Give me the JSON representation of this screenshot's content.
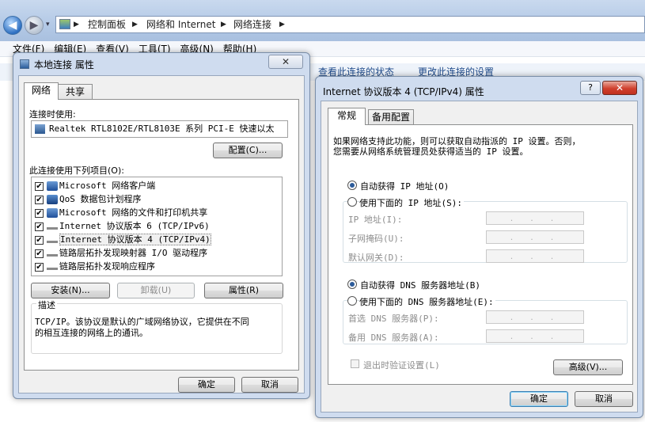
{
  "explorer": {
    "breadcrumb": [
      "控制面板",
      "网络和 Internet",
      "网络连接"
    ],
    "menu": [
      "文件(F)",
      "编辑(E)",
      "查看(V)",
      "工具(T)",
      "高级(N)",
      "帮助(H)"
    ],
    "commands": [
      "查看此连接的状态",
      "更改此连接的设置"
    ]
  },
  "lan_dialog": {
    "title": "本地连接 属性",
    "close_glyph": "✕",
    "tabs": [
      "网络",
      "共享"
    ],
    "connect_using_label": "连接时使用:",
    "adapter_name": "Realtek RTL8102E/RTL8103E 系列 PCI-E 快速以太",
    "configure_button": "配置(C)...",
    "items_label": "此连接使用下列项目(O):",
    "items": [
      {
        "name": "Microsoft 网络客户端",
        "checked": true,
        "icon": "network-client-icon"
      },
      {
        "name": "QoS 数据包计划程序",
        "checked": true,
        "icon": "qos-icon"
      },
      {
        "name": "Microsoft 网络的文件和打印机共享",
        "checked": true,
        "icon": "file-share-icon"
      },
      {
        "name": "Internet 协议版本 6 (TCP/IPv6)",
        "checked": true,
        "icon": "protocol-icon"
      },
      {
        "name": "Internet 协议版本 4 (TCP/IPv4)",
        "checked": true,
        "icon": "protocol-icon"
      },
      {
        "name": "链路层拓扑发现映射器 I/O 驱动程序",
        "checked": true,
        "icon": "protocol-icon"
      },
      {
        "name": "链路层拓扑发现响应程序",
        "checked": true,
        "icon": "protocol-icon"
      }
    ],
    "install_button": "安装(N)...",
    "uninstall_button": "卸载(U)",
    "properties_button": "属性(R)",
    "description_label": "描述",
    "description_text_1": "TCP/IP。该协议是默认的广域网络协议，它提供在不同",
    "description_text_2": "的相互连接的网络上的通讯。",
    "ok_button": "确定",
    "cancel_button": "取消"
  },
  "ipv4_dialog": {
    "title": "Internet 协议版本 4 (TCP/IPv4) 属性",
    "help_glyph": "?",
    "close_glyph": "✕",
    "tabs": [
      "常规",
      "备用配置"
    ],
    "intro_line_1": "如果网络支持此功能，则可以获取自动指派的 IP 设置。否则，",
    "intro_line_2": "您需要从网络系统管理员处获得适当的 IP 设置。",
    "auto_ip": "自动获得 IP 地址(O)",
    "manual_ip": "使用下面的 IP 地址(S):",
    "ip_address_label": "IP 地址(I):",
    "subnet_label": "子网掩码(U):",
    "gateway_label": "默认网关(D):",
    "auto_dns": "自动获得 DNS 服务器地址(B)",
    "manual_dns": "使用下面的 DNS 服务器地址(E):",
    "preferred_dns_label": "首选 DNS 服务器(P):",
    "alternate_dns_label": "备用 DNS 服务器(A):",
    "ip_placeholder": "...",
    "validate_on_exit": "退出时验证设置(L)",
    "advanced_button": "高级(V)...",
    "ok_button": "确定",
    "cancel_button": "取消",
    "auto_ip_selected": true,
    "auto_dns_selected": true
  },
  "colors": {
    "accent": "#3c7fb1",
    "close_red": "#c0301f",
    "frame": "#cfdcef"
  }
}
